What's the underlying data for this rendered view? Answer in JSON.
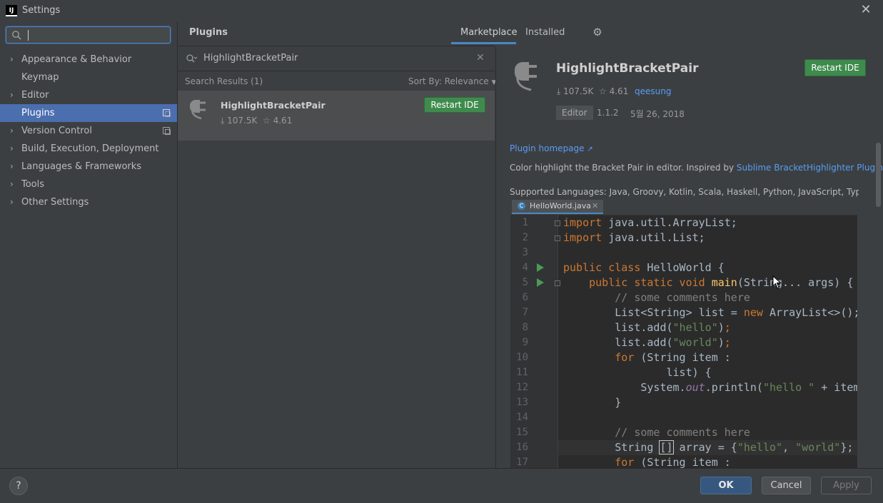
{
  "window": {
    "title": "Settings",
    "app_icon": "IJ"
  },
  "search": {
    "value": "",
    "placeholder": ""
  },
  "sidebar": {
    "items": [
      {
        "label": "Appearance & Behavior",
        "expandable": true
      },
      {
        "label": "Keymap",
        "expandable": false
      },
      {
        "label": "Editor",
        "expandable": true
      },
      {
        "label": "Plugins",
        "expandable": false,
        "selected": true
      },
      {
        "label": "Version Control",
        "expandable": true
      },
      {
        "label": "Build, Execution, Deployment",
        "expandable": true
      },
      {
        "label": "Languages & Frameworks",
        "expandable": true
      },
      {
        "label": "Tools",
        "expandable": true
      },
      {
        "label": "Other Settings",
        "expandable": true
      }
    ]
  },
  "plugins_panel": {
    "title": "Plugins",
    "tabs": [
      "Marketplace",
      "Installed"
    ],
    "active_tab": "Marketplace",
    "search_value": "HighlightBracketPair",
    "results_label": "Search Results (1)",
    "sort_label": "Sort By: Relevance",
    "results": [
      {
        "name": "HighlightBracketPair",
        "downloads": "107.5K",
        "rating": "4.61",
        "button": "Restart IDE"
      }
    ]
  },
  "detail": {
    "name": "HighlightBracketPair",
    "downloads": "107.5K",
    "rating": "4.61",
    "author": "qeesung",
    "category": "Editor",
    "version": "1.1.2",
    "date": "5월 26, 2018",
    "button": "Restart IDE",
    "homepage": "Plugin homepage",
    "description_prefix": "Color highlight the Bracket Pair in editor. Inspired by ",
    "description_link": "Sublime BracketHighlighter Plugin",
    "supported_languages": "Supported Languages: Java, Groovy, Kotlin, Scala, Haskell, Python, JavaScript, TypeScript, C"
  },
  "code_preview": {
    "file_tab": "HelloWorld.java",
    "line_numbers": [
      "1",
      "2",
      "3",
      "4",
      "5",
      "6",
      "7",
      "8",
      "9",
      "10",
      "11",
      "12",
      "13",
      "14",
      "15",
      "16",
      "17"
    ]
  },
  "footer": {
    "help": "?",
    "ok": "OK",
    "cancel": "Cancel",
    "apply": "Apply"
  },
  "colors": {
    "accent": "#4b6eaf",
    "restart_button": "#3f8b4e",
    "link": "#589df6",
    "background": "#3c3f41",
    "editor_bg": "#2b2b2b"
  }
}
